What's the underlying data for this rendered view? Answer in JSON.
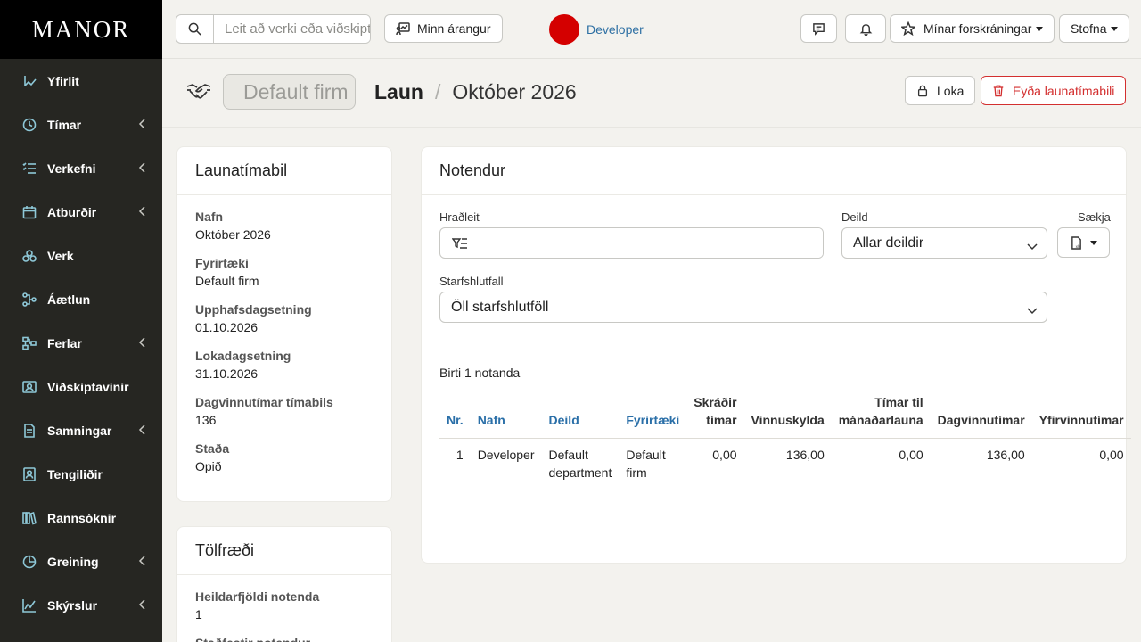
{
  "brand": "MANOR",
  "sidebar": {
    "items": [
      {
        "label": "Yfirlit",
        "icon": "overview-icon",
        "chevron": false
      },
      {
        "label": "Tímar",
        "icon": "clock-icon",
        "chevron": true
      },
      {
        "label": "Verkefni",
        "icon": "task-list-icon",
        "chevron": true
      },
      {
        "label": "Atburðir",
        "icon": "calendar-icon",
        "chevron": true
      },
      {
        "label": "Verk",
        "icon": "project-icon",
        "chevron": false
      },
      {
        "label": "Áætlun",
        "icon": "plan-icon",
        "chevron": false
      },
      {
        "label": "Ferlar",
        "icon": "process-icon",
        "chevron": true
      },
      {
        "label": "Viðskiptavinir",
        "icon": "customers-icon",
        "chevron": false
      },
      {
        "label": "Samningar",
        "icon": "contract-icon",
        "chevron": true
      },
      {
        "label": "Tengiliðir",
        "icon": "contacts-icon",
        "chevron": false
      },
      {
        "label": "Rannsóknir",
        "icon": "research-icon",
        "chevron": false
      },
      {
        "label": "Greining",
        "icon": "analysis-icon",
        "chevron": true
      },
      {
        "label": "Skýrslur",
        "icon": "reports-icon",
        "chevron": true
      }
    ]
  },
  "topbar": {
    "search_placeholder": "Leit að verki eða viðskiptavini",
    "my_results": "Minn árangur",
    "user_name": "Developer",
    "my_bookmarks": "Mínar forskráningar",
    "create": "Stofna"
  },
  "page": {
    "firm": "Default firm",
    "title": "Laun",
    "separator": "/",
    "period": "Október 2026",
    "lock_label": "Loka",
    "delete_label": "Eyða launatímabili"
  },
  "period_card": {
    "title": "Launatímabil",
    "fields": [
      {
        "label": "Nafn",
        "value": "Október 2026"
      },
      {
        "label": "Fyrirtæki",
        "value": "Default firm"
      },
      {
        "label": "Upphafsdagsetning",
        "value": "01.10.2026"
      },
      {
        "label": "Lokadagsetning",
        "value": "31.10.2026"
      },
      {
        "label": "Dagvinnutímar tímabils",
        "value": "136"
      },
      {
        "label": "Staða",
        "value": "Opið"
      }
    ]
  },
  "stats_card": {
    "title": "Tölfræði",
    "fields": [
      {
        "label": "Heildarfjöldi notenda",
        "value": "1"
      },
      {
        "label": "Staðfestir notendur",
        "value": ""
      }
    ]
  },
  "users_card": {
    "title": "Notendur",
    "quick_search_label": "Hraðleit",
    "quick_search_value": "",
    "department_label": "Deild",
    "department_value": "Allar deildir",
    "download_label": "Sækja",
    "employment_label": "Starfshlutfall",
    "employment_value": "Öll starfshlutföll",
    "count_text": "Birti 1 notanda",
    "columns": [
      "Nr.",
      "Nafn",
      "Deild",
      "Fyrirtæki",
      "Skráðir tímar",
      "Vinnuskylda",
      "Tímar til mánaðarlauna",
      "Dagvinnutímar",
      "Yfirvinnutímar"
    ],
    "rows": [
      [
        "1",
        "Developer",
        "Default department",
        "Default firm",
        "0,00",
        "136,00",
        "0,00",
        "136,00",
        "0,00"
      ]
    ]
  },
  "colors": {
    "sidebar_bg": "#262622",
    "brand_bg": "#000000",
    "accent_blue": "#2a6fa8",
    "danger": "#d32f2f",
    "avatar": "#d40000"
  }
}
